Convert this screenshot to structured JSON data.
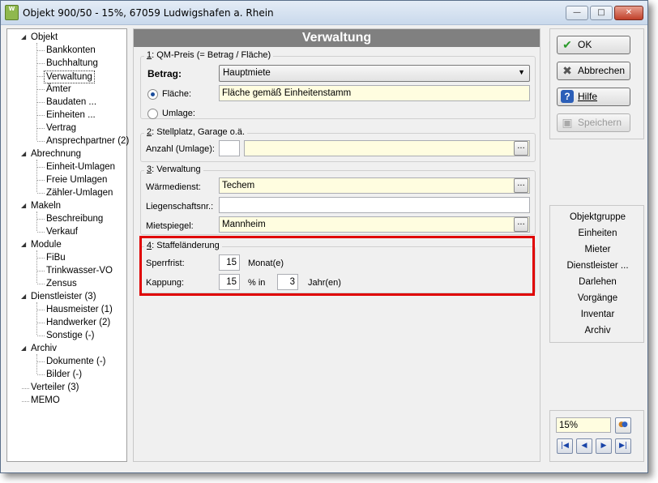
{
  "window": {
    "title": "Objekt 900/50 - 15%, 67059 Ludwigshafen a. Rhein",
    "app_icon_text": "W"
  },
  "titlebar_buttons": {
    "minimize": "—",
    "maximize": "□",
    "close": "✕"
  },
  "tree": {
    "groups": [
      {
        "label": "Objekt",
        "children": [
          "Bankkonten",
          "Buchhaltung",
          "Verwaltung",
          "Ämter",
          "Baudaten ...",
          "Einheiten ...",
          "Vertrag",
          "Ansprechpartner (2)"
        ]
      },
      {
        "label": "Abrechnung",
        "children": [
          "Einheit-Umlagen",
          "Freie Umlagen",
          "Zähler-Umlagen"
        ]
      },
      {
        "label": "Makeln",
        "children": [
          "Beschreibung",
          "Verkauf"
        ]
      },
      {
        "label": "Module",
        "children": [
          "FiBu",
          "Trinkwasser-VO",
          "Zensus"
        ]
      },
      {
        "label": "Dienstleister (3)",
        "children": [
          "Hausmeister (1)",
          "Handwerker (2)",
          "Sonstige (-)"
        ]
      },
      {
        "label": "Archiv",
        "children": [
          "Dokumente (-)",
          "Bilder (-)"
        ]
      },
      {
        "label": "Verteiler (3)",
        "children": []
      },
      {
        "label": "MEMO",
        "children": []
      }
    ],
    "selected": "Verwaltung"
  },
  "main": {
    "header": "Verwaltung",
    "qm_preis": {
      "legend_num": "1",
      "legend_text": ": QM-Preis (= Betrag / Fläche)",
      "betrag_label": "Betrag:",
      "betrag_value": "Hauptmiete",
      "flaeche_label": "Fläche:",
      "flaeche_value": "Fläche gemäß Einheitenstamm",
      "umlage_label": "Umlage:"
    },
    "stellplatz": {
      "legend_num": "2",
      "legend_text": ": Stellplatz, Garage o.ä.",
      "anzahl_label": "Anzahl (Umlage):",
      "anzahl_value": "",
      "umlage_value": ""
    },
    "verwaltung": {
      "legend_num": "3",
      "legend_text": ": Verwaltung",
      "waermedienst_label": "Wärmedienst:",
      "waermedienst_value": "Techem",
      "liegenschaft_label": "Liegenschaftsnr.:",
      "liegenschaft_value": "",
      "mietspiegel_label": "Mietspiegel:",
      "mietspiegel_value": "Mannheim"
    },
    "staffel": {
      "legend_num": "4",
      "legend_text": ": Staffeländerung",
      "sperrfrist_label": "Sperrfrist:",
      "sperrfrist_value": "15",
      "sperrfrist_unit": "Monat(e)",
      "kappung_label": "Kappung:",
      "kappung_value": "15",
      "kappung_pct": "% in",
      "kappung_years": "3",
      "kappung_unit": "Jahr(en)"
    },
    "dots": "..."
  },
  "actions": {
    "ok": "OK",
    "abbrechen": "Abbrechen",
    "hilfe": "Hilfe",
    "speichern": "Speichern"
  },
  "nav_links": [
    "Objektgruppe",
    "Einheiten",
    "Mieter",
    "Dienstleister ...",
    "Darlehen",
    "Vorgänge",
    "Inventar",
    "Archiv"
  ],
  "footer": {
    "percent": "15%"
  },
  "colors": {
    "highlight": "#e00000",
    "yellow_field": "#fffde0",
    "header_bg": "#808080"
  }
}
